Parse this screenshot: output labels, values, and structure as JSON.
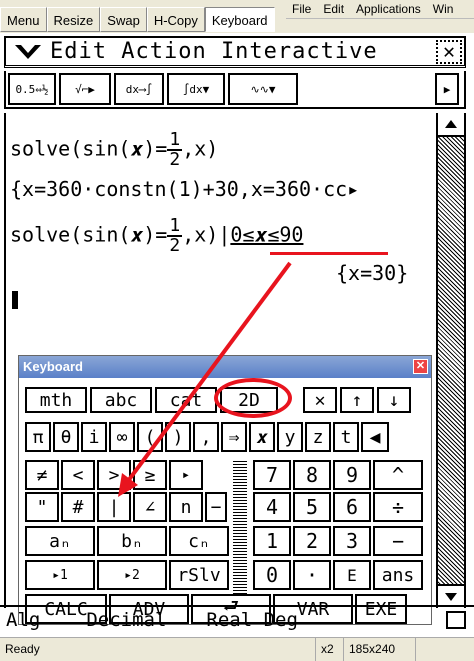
{
  "window": {
    "menu_left": [
      "Menu",
      "Resize",
      "Swap",
      "H-Copy",
      "Keyboard"
    ],
    "menu_right": [
      "File",
      "Edit",
      "Applications",
      "Win"
    ]
  },
  "app": {
    "menus": "Edit Action Interactive",
    "close_label": "✕",
    "toolbar": [
      "0.5⇔½",
      "√⌐▶",
      "dx⟶∫",
      "∫dx▼",
      "∿∿▼",
      "▶"
    ]
  },
  "work": {
    "line1": {
      "prefix": "solve(sin(𝒙)=",
      "num": "1",
      "den": "2",
      "suffix": ",x)"
    },
    "line2": "{x=360·constn(1)+30,x=360·cc▸",
    "line3": {
      "prefix": "solve(sin(𝒙)=",
      "num": "1",
      "den": "2",
      "suffix": ",x)",
      "cond": "0≤𝒙≤90"
    },
    "line4": "{x=30}"
  },
  "keyboard": {
    "title": "Keyboard",
    "close": "✕",
    "tabs": [
      "mth",
      "abc",
      "cat",
      "2D"
    ],
    "tab_icons": [
      "✕",
      "↑",
      "↓"
    ],
    "row1": [
      "π",
      "θ",
      "i",
      "∞",
      "(",
      ")",
      ",",
      "⇒",
      "𝒙",
      "y",
      "z",
      "t",
      "◀"
    ],
    "left": {
      "r1": [
        "≠",
        "<",
        ">",
        "≥",
        "▸"
      ],
      "r2": [
        "\"",
        "#",
        "|",
        "∠",
        "n",
        "−"
      ],
      "r3": [
        "aₙ",
        "bₙ",
        "cₙ"
      ],
      "r4": [
        "▸1",
        "▸2",
        "rSlv"
      ]
    },
    "right": {
      "r1": [
        "7",
        "8",
        "9",
        "^"
      ],
      "r2": [
        "4",
        "5",
        "6",
        "÷"
      ],
      "r3": [
        "1",
        "2",
        "3",
        "−"
      ],
      "r4": [
        "0",
        "·",
        "E",
        "ans"
      ]
    },
    "bottom": [
      "CALC",
      "ADV",
      "⮐",
      "VAR",
      "EXE"
    ]
  },
  "status": {
    "mode": "Alg",
    "format": "Decimal",
    "angle": "Real Deg"
  },
  "winstatus": {
    "ready": "Ready",
    "zoom": "x2",
    "size": "185x240"
  },
  "colors": {
    "annotation": "#e8141e"
  }
}
